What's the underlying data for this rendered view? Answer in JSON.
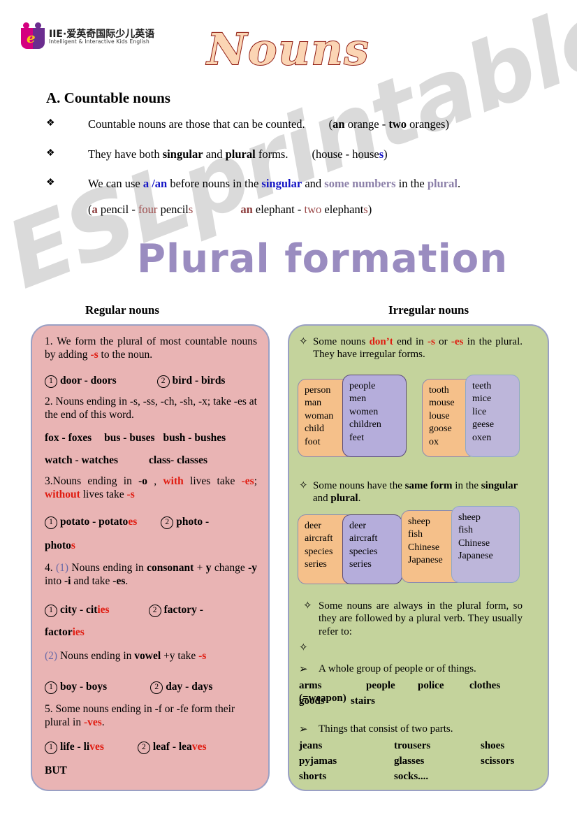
{
  "watermark": "ESLprintables.com",
  "logo": {
    "name_cn": "IIE·爱英奇国际少儿英语",
    "name_en": "Intelligent & Interactive Kids English",
    "letter": "e"
  },
  "title": "Nouns",
  "section_a": {
    "heading": "A. Countable nouns",
    "bullets": [
      {
        "mark": "❖",
        "pre": "Countable nouns are those that can be counted.",
        "example_open": "(",
        "ex_bold1": "an",
        "ex_plain1": " orange - ",
        "ex_bold2": "two",
        "ex_plain2": " oranges)"
      },
      {
        "mark": "❖",
        "pre1": "They have both ",
        "b1": "singular",
        "mid": " and ",
        "b2": "plural",
        "pre2": " forms.",
        "ex_plain": "(house - house",
        "ex_blue": "s",
        "ex_close": ")"
      },
      {
        "mark": "❖",
        "t1": "We can use ",
        "blue1": "a /an",
        "t2": " before nouns in the ",
        "blue2": "singular",
        "t3": " and ",
        "mauve1": "some numbers",
        "t4": " in the ",
        "mauve2": "plural",
        "t5": "."
      }
    ],
    "subline": {
      "open": "(",
      "a": "a",
      "p1": " pencil - ",
      "four": "four",
      "p2": " pencil",
      "s1": "s",
      "an": "an",
      "p3": " elephant - ",
      "two": "two",
      "p4": " elephant",
      "s2": "s",
      "close": ")"
    }
  },
  "plural_formation_heading": "Plural formation",
  "columns": {
    "left_heading": "Regular nouns",
    "right_heading": "Irregular nouns"
  },
  "regular": {
    "rule1": {
      "text_a": "1. We form the plural of most countable nouns by adding ",
      "suffix": "-s",
      "text_b": " to the noun."
    },
    "ex1": {
      "n1": "1",
      "t1": "door - doors",
      "n2": "2",
      "t2": "bird - birds"
    },
    "rule2": {
      "text_a": "2. Nouns ending in -s, -ss, -ch, -sh, -x; take -es at the end of this word."
    },
    "ex2_line1": [
      "fox - foxes",
      "bus - buses",
      "bush - bushes"
    ],
    "ex2_line2": [
      "watch - watches",
      "class- classes"
    ],
    "rule3": {
      "a": "3.Nouns ending in ",
      "o": "-o",
      "b": " , ",
      "with": "with",
      "c": " lives take ",
      "es": "-es",
      "d": "; ",
      "without": "without",
      "e": " lives take ",
      "s": "-s"
    },
    "ex3": {
      "n1": "1",
      "t1a": "potato  -  potato",
      "t1b": "es",
      "n2": "2",
      "t2a": "photo  -",
      "t2b": "photo",
      "t2c": "s"
    },
    "rule4": {
      "num": "4.",
      "sub": "(1)",
      "a": " Nouns ending in ",
      "b": "consonant",
      "c": " + ",
      "d": "y",
      "e": " change ",
      "f": "-y",
      "g": " into ",
      "h": "-i",
      "i": " and take ",
      "j": "-es",
      "k": "."
    },
    "ex4": {
      "n1": "1",
      "t1a": "city  -  cit",
      "t1b": "ies",
      "n2": "2",
      "t2a": "factory  -",
      "t2b": "factor",
      "t2c": "ies"
    },
    "rule4b": {
      "sub": "(2)",
      "a": "  Nouns ending in ",
      "b": "vowel",
      "c": " +y take ",
      "d": "-s"
    },
    "ex5": {
      "n1": "1",
      "t1": "boy - boys",
      "n2": "2",
      "t2": "day - days"
    },
    "rule5": {
      "a": "5. Some nouns ending in -f or -fe form their plural in ",
      "b": "-ves",
      "c": "."
    },
    "ex6": {
      "n1": "1",
      "t1a": "life - li",
      "t1b": "ves",
      "n2": "2",
      "t2a": "leaf - lea",
      "t2b": "ves"
    },
    "but": "BUT"
  },
  "irregular": {
    "b1": {
      "mark": "✧",
      "a": "Some nouns ",
      "dont": "don’t",
      "b": " end in ",
      "s": "-s",
      "c": " or ",
      "es": "-es",
      "d": " in the plural. They have irregular forms."
    },
    "wordboxes_1": [
      {
        "color": "orange",
        "words": [
          "person",
          "man",
          "woman",
          "child",
          "foot"
        ]
      },
      {
        "color": "purple",
        "words": [
          "people",
          "men",
          "women",
          "children",
          "feet"
        ]
      },
      {
        "color": "orange",
        "words": [
          "tooth",
          "mouse",
          "louse",
          "goose",
          "ox"
        ]
      },
      {
        "color": "purple",
        "words": [
          "teeth",
          "mice",
          "lice",
          "geese",
          "oxen"
        ]
      }
    ],
    "b2": {
      "mark": "✧",
      "a": "Some nouns have the ",
      "b": "same form",
      "c": " in the ",
      "d": "singular",
      "e": " and ",
      "f": "plural",
      "g": "."
    },
    "wordboxes_2": [
      {
        "color": "orange",
        "words": [
          "deer",
          "aircraft",
          "species",
          "series"
        ]
      },
      {
        "color": "purple",
        "words": [
          "deer",
          "aircraft",
          "species",
          "series"
        ]
      },
      {
        "color": "orange",
        "words": [
          "sheep",
          "fish",
          "Chinese",
          "Japanese"
        ]
      },
      {
        "color": "purple",
        "words": [
          "sheep",
          "fish",
          "Chinese",
          "Japanese"
        ]
      }
    ],
    "b3": {
      "mark": "✧",
      "text": "Some nouns are always in the plural form, so they are followed by a plural verb. They usually refer to:"
    },
    "b3_empty_mark": "✧",
    "b4": {
      "mark": "➢",
      "text": "A whole group of people or of things."
    },
    "b4_words_line1": [
      "arms  (=weapon)",
      "people",
      "police",
      "clothes"
    ],
    "b4_words_line2": [
      "goods",
      "stairs"
    ],
    "b5": {
      "mark": "➢",
      "text": "Things that consist of two parts."
    },
    "b5_rows": [
      [
        "jeans",
        "trousers",
        "shoes"
      ],
      [
        "pyjamas",
        "glasses",
        "scissors"
      ],
      [
        "shorts",
        "socks....",
        ""
      ]
    ]
  },
  "colors": {
    "pink_box": "#e9b4b4",
    "green_box": "#c4d39c",
    "orange_wordbox": "#f5c08a",
    "purple_wordbox": "#b5addb",
    "red_accent": "#e01b10",
    "blue_accent": "#1313c4",
    "mauve_accent": "#8b7fa8",
    "title_fill": "#fbd5b4",
    "title_stroke": "#8f1a10",
    "plural_heading": "#9a8cc0"
  }
}
